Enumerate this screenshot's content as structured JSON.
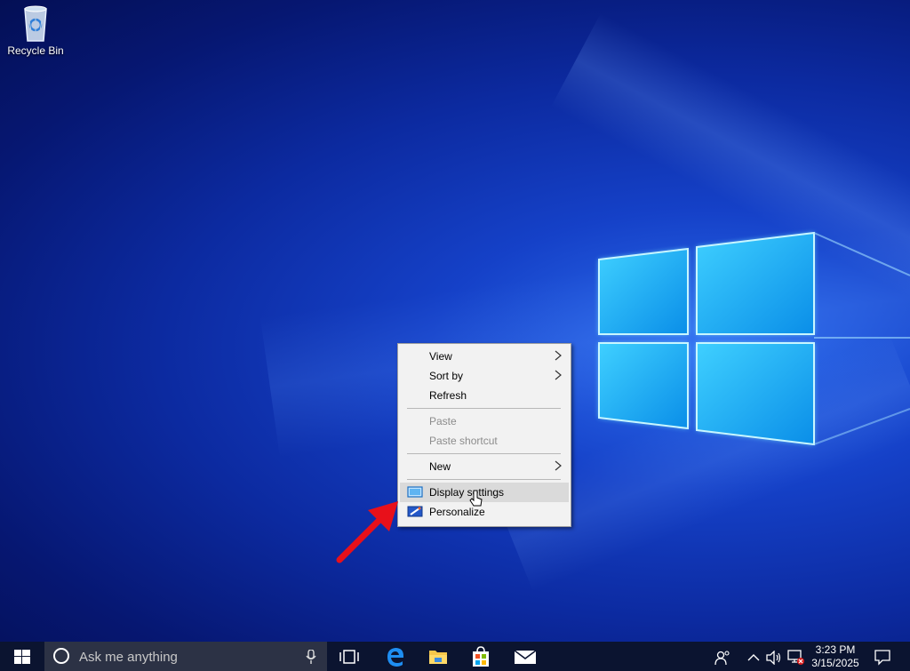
{
  "desktop": {
    "icons": [
      {
        "label": "Recycle Bin",
        "icon": "recycle-bin-icon"
      }
    ]
  },
  "context_menu": {
    "items": [
      {
        "label": "View",
        "has_submenu": true,
        "disabled": false
      },
      {
        "label": "Sort by",
        "has_submenu": true,
        "disabled": false
      },
      {
        "label": "Refresh",
        "has_submenu": false,
        "disabled": false
      },
      {
        "label": "Paste",
        "has_submenu": false,
        "disabled": true
      },
      {
        "label": "Paste shortcut",
        "has_submenu": false,
        "disabled": true
      },
      {
        "label": "New",
        "has_submenu": true,
        "disabled": false
      },
      {
        "label": "Display settings",
        "icon": "display-settings-icon",
        "highlighted": true
      },
      {
        "label": "Personalize",
        "icon": "personalize-icon"
      }
    ]
  },
  "taskbar": {
    "search_placeholder": "Ask me anything",
    "clock_time": "3:23 PM",
    "clock_date": "3/15/2025",
    "apps": [
      "task-view-icon",
      "edge-icon",
      "file-explorer-icon",
      "store-icon",
      "mail-icon"
    ],
    "tray": [
      "people-icon",
      "chevron-up-icon",
      "volume-icon",
      "network-disconnected-icon",
      "action-center-icon"
    ]
  },
  "colors": {
    "accent_arrow": "#e8101a",
    "taskbar": "#0b1430",
    "menu_bg": "#f2f2f2",
    "menu_hover": "#dadada"
  }
}
